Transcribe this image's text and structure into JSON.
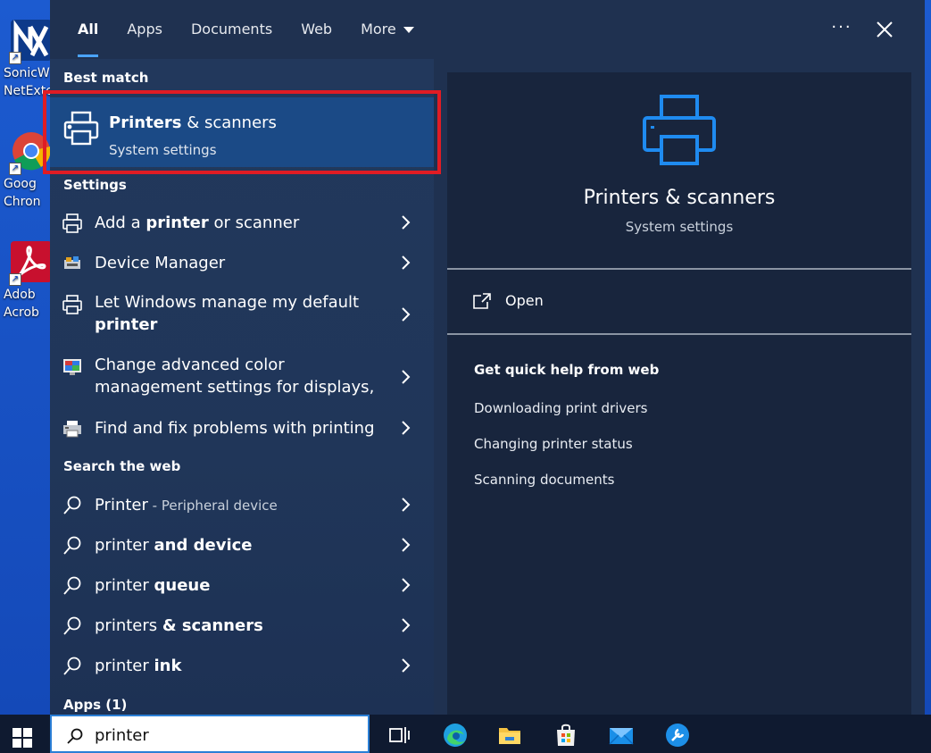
{
  "desktop": {
    "icons": [
      {
        "label_line1": "SonicW",
        "label_line2": "NetExte"
      },
      {
        "label_line1": "Goog",
        "label_line2": "Chron"
      },
      {
        "label_line1": "Adob",
        "label_line2": "Acrob"
      }
    ]
  },
  "tabs": {
    "items": [
      {
        "label": "All"
      },
      {
        "label": "Apps"
      },
      {
        "label": "Documents"
      },
      {
        "label": "Web"
      },
      {
        "label": "More"
      }
    ]
  },
  "left": {
    "best_match_header": "Best match",
    "best_match": {
      "title_bold": "Printers",
      "title_rest": " & scanners",
      "subtitle": "System settings"
    },
    "settings_header": "Settings",
    "settings": [
      {
        "pre": "Add a ",
        "bold": "printer",
        "post": " or scanner",
        "icon": "printer-icon"
      },
      {
        "pre": "Device Manager",
        "bold": "",
        "post": "",
        "icon": "device-manager-icon"
      },
      {
        "pre": "Let Windows manage my default",
        "bold": "printer",
        "post": "",
        "icon": "printer-icon"
      },
      {
        "line1": "Change advanced color",
        "line2": "management settings for displays,",
        "icon": "color-management-icon"
      },
      {
        "pre": "Find and fix problems with printing",
        "bold": "",
        "post": "",
        "icon": "troubleshoot-icon"
      }
    ],
    "web_header": "Search the web",
    "web": [
      {
        "pre": "Printer",
        "bold": "",
        "sub": " - Peripheral device"
      },
      {
        "pre": "printer ",
        "bold": "and device"
      },
      {
        "pre": "printer ",
        "bold": "queue"
      },
      {
        "pre": "printers ",
        "bold": "& scanners"
      },
      {
        "pre": "printer ",
        "bold": "ink"
      }
    ],
    "apps_header": "Apps (1)"
  },
  "right": {
    "title": "Printers & scanners",
    "subtitle": "System settings",
    "open_label": "Open",
    "help_header": "Get quick help from web",
    "help_links": [
      "Downloading print drivers",
      "Changing printer status",
      "Scanning documents"
    ]
  },
  "taskbar": {
    "search_value": "printer",
    "apps": [
      "task-view-icon",
      "edge-icon",
      "file-explorer-icon",
      "store-icon",
      "mail-icon",
      "remote-tool-icon"
    ]
  },
  "colors": {
    "accent": "#4aa3ff",
    "highlight_border": "#e01c24",
    "panel_bg": "#1f3150",
    "right_bg": "#18253d",
    "selected_bg": "#1b4a86",
    "printer_blue": "#1f8bf0"
  }
}
